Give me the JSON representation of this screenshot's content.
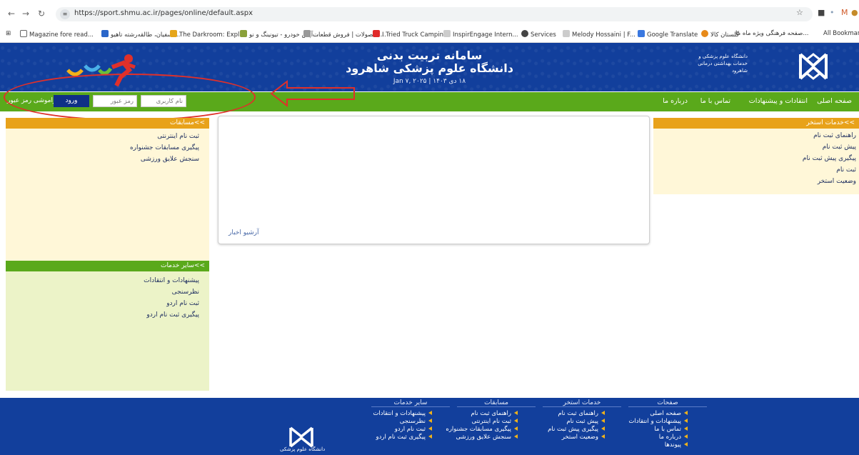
{
  "browser": {
    "url": "https://sport.shmu.ac.ir/pages/online/default.aspx",
    "bookmarks": [
      "Magazine fore read...",
      "سفیان، طالقه‌رشته تاهیو ...",
      "The Darkroom: Expl...",
      "آپش خودرو - تیونینگ و نو...",
      "محصولات | فروش قطعات...",
      "I Tried Truck Campin...",
      "InspirEngage Intern...",
      "Services",
      "Melody Hossaini | F...",
      "Google Translate",
      "گلستان کالا",
      "صفحه فرهنگی ویژه ماه ما...",
      "All Bookmarks"
    ]
  },
  "header": {
    "title1": "سامانه تربیت بدنی",
    "title2": "دانشگاه علوم پزشکی شاهرود",
    "date": "۱۸ دی ۱۴۰۳ | Jan ۷, ۲۰۲۵",
    "logo_text": "دانشگاه علوم پزشکی و خدمات بهداشتی درمانی شاهرود"
  },
  "nav": {
    "items": [
      "صفحه اصلی",
      "انتقادات و پیشنهادات",
      "تماس با ما",
      "درباره ما"
    ],
    "username_placeholder": "نام کاربری",
    "password_placeholder": "رمز عبور",
    "login_label": "ورود",
    "forgot_label": "فراموشی رمز عبور"
  },
  "left_panel": {
    "competitions_title": ">>مسابقات",
    "competitions": [
      "ثبت نام اینترنتی",
      "پیگیری مسابقات جشنواره",
      "سنجش علایق ورزشی"
    ],
    "other_title": ">>سایر خدمات",
    "other": [
      "پیشنهادات و انتقادات",
      "نظرسنجی",
      "ثبت نام اردو",
      "پیگیری ثبت نام اردو"
    ]
  },
  "right_panel": {
    "title": ">>خدمات استخر",
    "items": [
      "راهنمای ثبت نام",
      "پیش ثبت نام",
      "پیگیری پیش ثبت نام",
      "ثبت نام",
      "وضعیت استخر"
    ]
  },
  "center": {
    "archive_label": "آرشیو اخبار"
  },
  "footer": {
    "columns": [
      {
        "title": "صفحات",
        "items": [
          "صفحه اصلی",
          "پیشنهادات و انتقادات",
          "تماس با ما",
          "درباره ما",
          "پیوندها"
        ]
      },
      {
        "title": "خدمات استخر",
        "items": [
          "راهنمای ثبت نام",
          "پیش ثبت نام",
          "پیگیری پیش ثبت نام",
          "وضعیت استخر"
        ]
      },
      {
        "title": "مسابقات",
        "items": [
          "راهنمای ثبت نام",
          "ثبت نام اینترنتی",
          "پیگیری مسابقات جشنواره",
          "سنجش علایق ورزشی"
        ]
      },
      {
        "title": "سایر خدمات",
        "items": [
          "پیشنهادات و انتقادات",
          "نظرسنجی",
          "ثبت نام اردو",
          "پیگیری ثبت نام اردو"
        ]
      }
    ],
    "logo_caption": "دانشگاه علوم پزشکی"
  },
  "colors": {
    "header_blue": "#123f9c",
    "nav_green": "#5aa91b",
    "panel_orange": "#e8a21a",
    "panel_cream": "#fff7d8",
    "annotation_red": "#e0302a"
  }
}
